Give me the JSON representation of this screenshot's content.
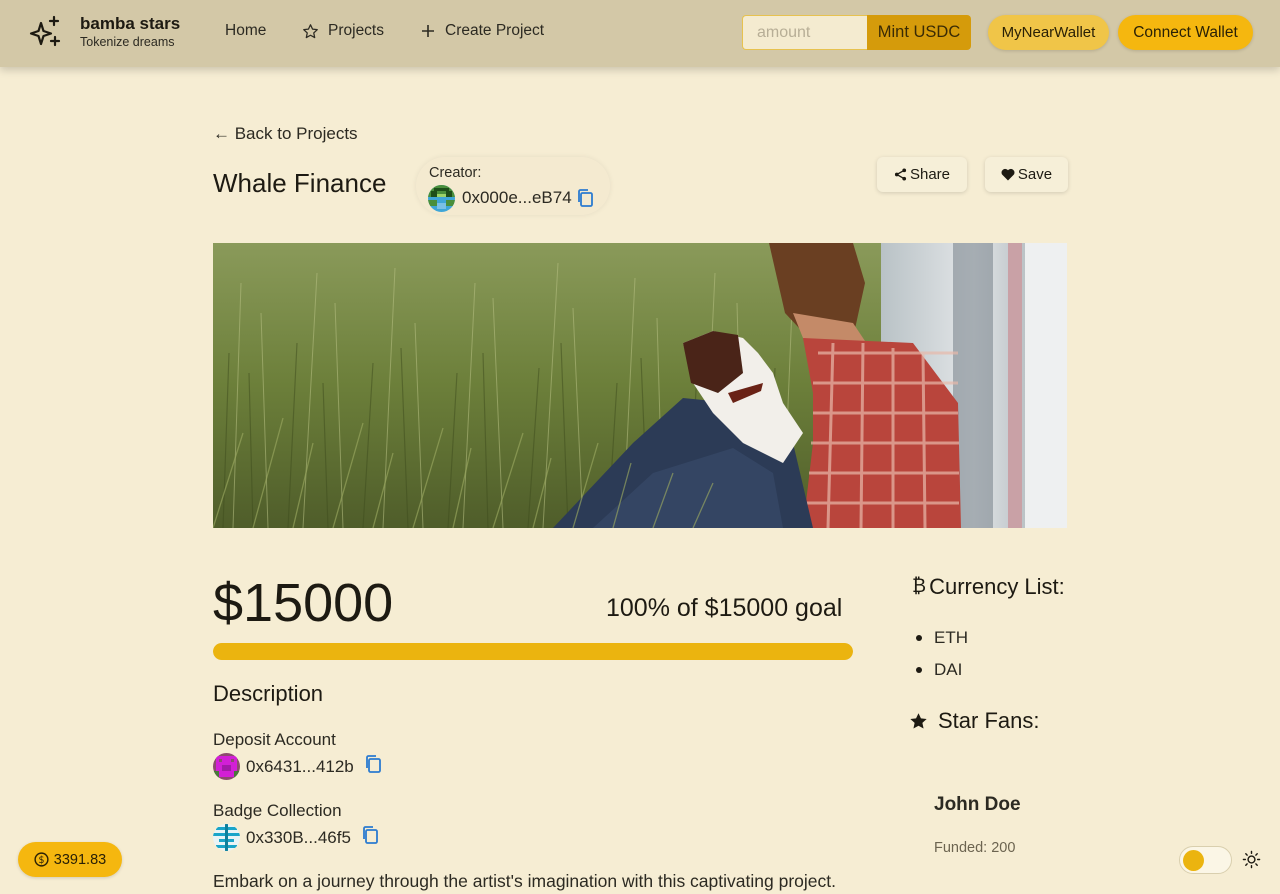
{
  "header": {
    "brand_name": "bamba stars",
    "brand_tagline": "Tokenize dreams",
    "nav": [
      {
        "label": "Home",
        "icon": ""
      },
      {
        "label": "Projects",
        "icon": "star-icon"
      },
      {
        "label": "Create Project",
        "icon": "plus-icon"
      }
    ],
    "amount_placeholder": "amount",
    "mint_label": "Mint USDC",
    "near_wallet_label": "MyNearWallet",
    "connect_wallet_label": "Connect Wallet"
  },
  "project": {
    "back_label": "← Back to Projects",
    "title": "Whale Finance",
    "creator_label": "Creator:",
    "creator_address": "0x000e...eB74",
    "share_label": "Share",
    "save_label": "Save"
  },
  "funding": {
    "raised": "$15000",
    "goal_text": "100% of $15000 goal",
    "progress": 1.0
  },
  "details": {
    "description_heading": "Description",
    "deposit_label": "Deposit Account",
    "deposit_address": "0x6431...412b",
    "badge_label": "Badge Collection",
    "badge_address": "0x330B...46f5",
    "description_text": "Embark on a journey through the artist's imagination with this captivating project."
  },
  "sidebar": {
    "currency_heading": "Currency List:",
    "currencies": [
      "ETH",
      "DAI"
    ],
    "fans_heading": "Star Fans:",
    "fans": [
      {
        "name": "John Doe",
        "funded": "Funded: 200"
      }
    ]
  },
  "footer": {
    "balance": "3391.83"
  },
  "colors": {
    "background": "#f6edd3",
    "navbar": "#d3c8a7",
    "accent": "#f5b70f",
    "progress": "#ebb40f",
    "copy_icon": "#2b7bd0"
  }
}
